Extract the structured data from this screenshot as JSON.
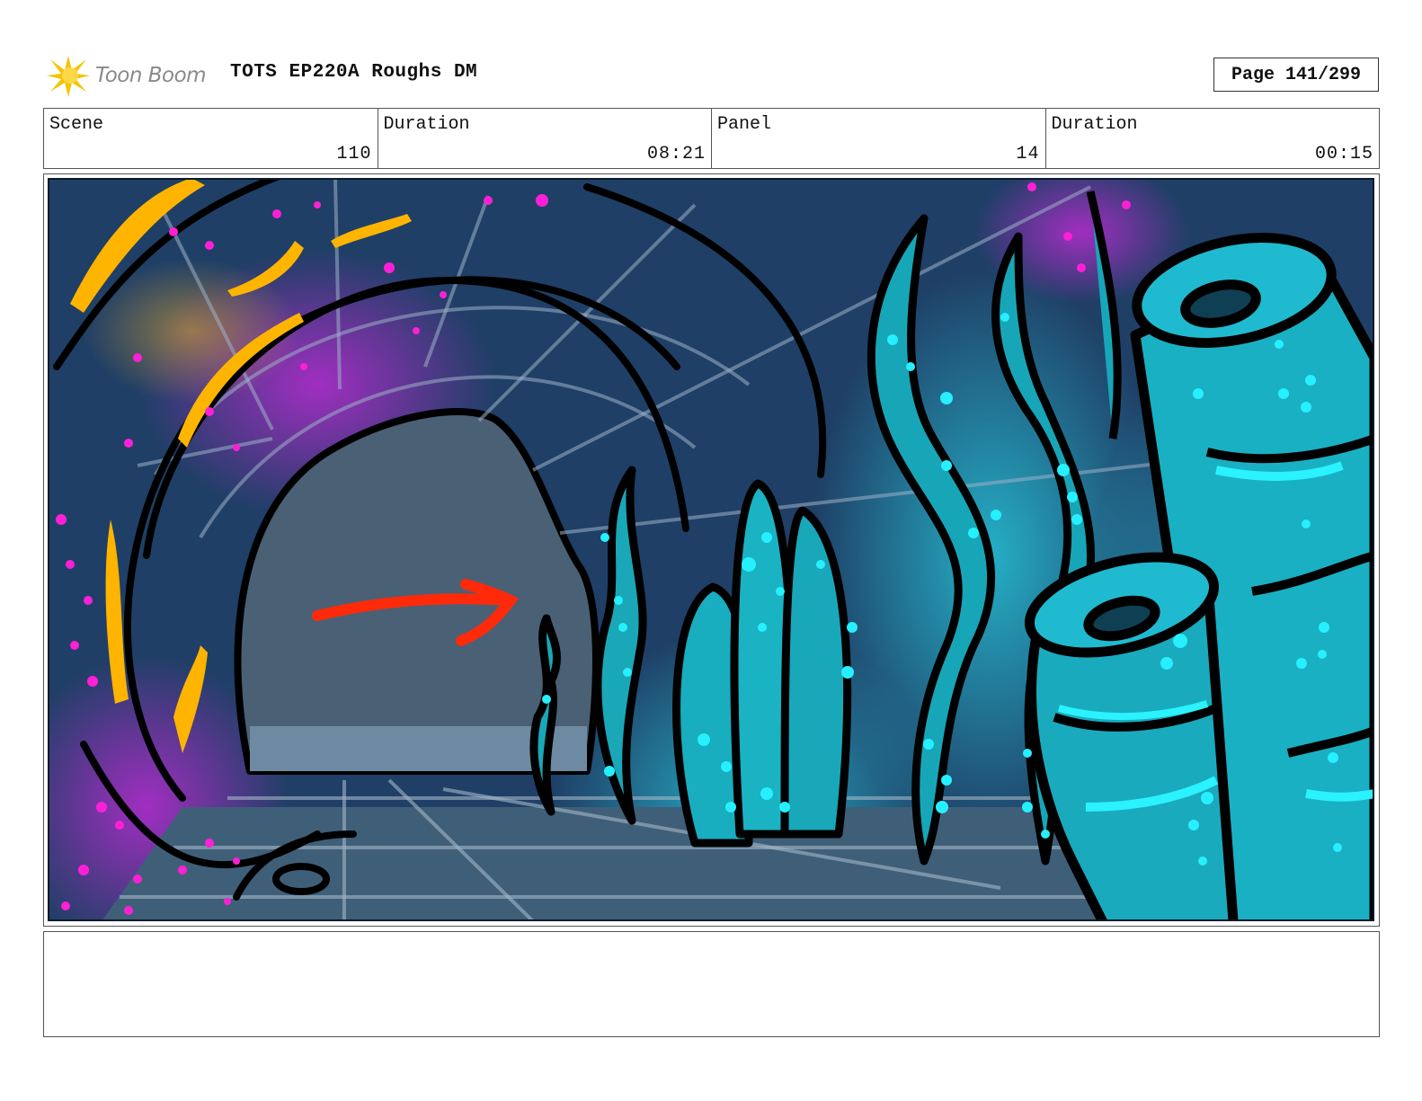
{
  "header": {
    "logo_text": "Toon Boom",
    "document_title": "TOTS EP220A Roughs DM",
    "page_label": "Page 141/299"
  },
  "info": {
    "scene_label": "Scene",
    "scene_value": "110",
    "scene_duration_label": "Duration",
    "scene_duration_value": "08:21",
    "panel_label": "Panel",
    "panel_value": "14",
    "panel_duration_label": "Duration",
    "panel_duration_value": "00:15"
  },
  "panel": {
    "description": "",
    "colors": {
      "background": "#1f3f66",
      "tunnel_opening": "#4a6075",
      "floor": "#3f5f78",
      "coral": "#1ab3c4",
      "glow_dots": "#26f0ff",
      "magenta_dots": "#ff1fd6",
      "orange_streaks": "#ffb400",
      "arrow": "#ff2a0a"
    }
  },
  "notes": {
    "text": ""
  }
}
